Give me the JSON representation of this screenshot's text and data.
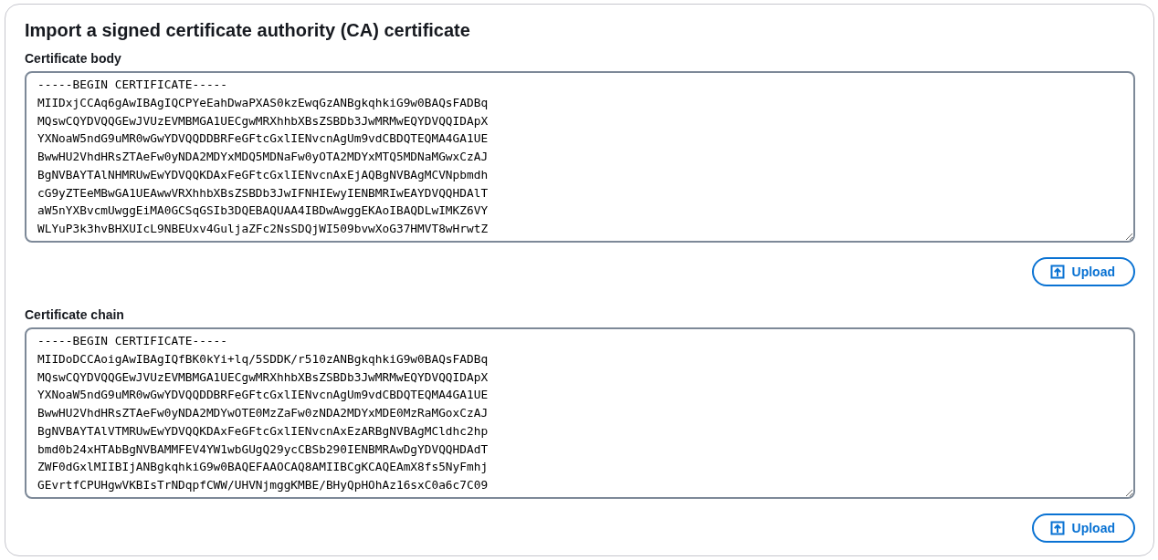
{
  "title": "Import a signed certificate authority (CA) certificate",
  "sections": [
    {
      "label": "Certificate body",
      "value_lines": [
        "-----BEGIN CERTIFICATE-----",
        "MIIDxjCCAq6gAwIBAgIQCPYeEahDwaPXAS0kzEwqGzANBgkqhkiG9w0BAQsFADBq",
        "MQswCQYDVQQGEwJVUzEVMBMGA1UECgwMRXhhbXBsZSBDb3JwMRMwEQYDVQQIDApX",
        "YXNoaW5ndG9uMR0wGwYDVQQDDBRFeGFtcGxlIENvcnAgUm9vdCBDQTEQMA4GA1UE",
        "BwwHU2VhdHRsZTAeFw0yNDA2MDYxMDQ5MDNaFw0yOTA2MDYxMTQ5MDNaMGwxCzAJ",
        "BgNVBAYTAlNHMRUwEwYDVQQKDAxFeGFtcGxlIENvcnAxEjAQBgNVBAgMCVNpbmdh",
        "cG9yZTEeMBwGA1UEAwwVRXhhbXBsZSBDb3JwIFNHIEwyIENBMRIwEAYDVQQHDAlT",
        "aW5nYXBvcmUwggEiMA0GCSqGSIb3DQEBAQUAA4IBDwAwggEKAoIBAQDLwIMKZ6VY",
        "WLYuP3k3hvBHXUIcL9NBEUxv4GuljaZFc2NsSDQjWI509bvwXoG37HMVT8wHrwtZ"
      ],
      "button": "Upload"
    },
    {
      "label": "Certificate chain",
      "value_lines": [
        "-----BEGIN CERTIFICATE-----",
        "MIIDoDCCAoigAwIBAgIQfBK0kYi+lq/5SDDK/r510zANBgkqhkiG9w0BAQsFADBq",
        "MQswCQYDVQQGEwJVUzEVMBMGA1UECgwMRXhhbXBsZSBDb3JwMRMwEQYDVQQIDApX",
        "YXNoaW5ndG9uMR0wGwYDVQQDDBRFeGFtcGxlIENvcnAgUm9vdCBDQTEQMA4GA1UE",
        "BwwHU2VhdHRsZTAeFw0yNDA2MDYwOTE0MzZaFw0zNDA2MDYxMDE0MzRaMGoxCzAJ",
        "BgNVBAYTAlVTMRUwEwYDVQQKDAxFeGFtcGxlIENvcnAxEzARBgNVBAgMCldhc2hp",
        "bmd0b24xHTAbBgNVBAMMFEV4YW1wbGUgQ29ycCBSb290IENBMRAwDgYDVQQHDAdT",
        "ZWF0dGxlMIIBIjANBgkqhkiG9w0BAQEFAAOCAQ8AMIIBCgKCAQEAmX8fs5NyFmhj",
        "GEvrtfCPUHgwVKBIsTrNDqpfCWW/UHVNjmggKMBE/BHyQpHOhAz16sxC0a6c7C09"
      ],
      "button": "Upload"
    }
  ]
}
